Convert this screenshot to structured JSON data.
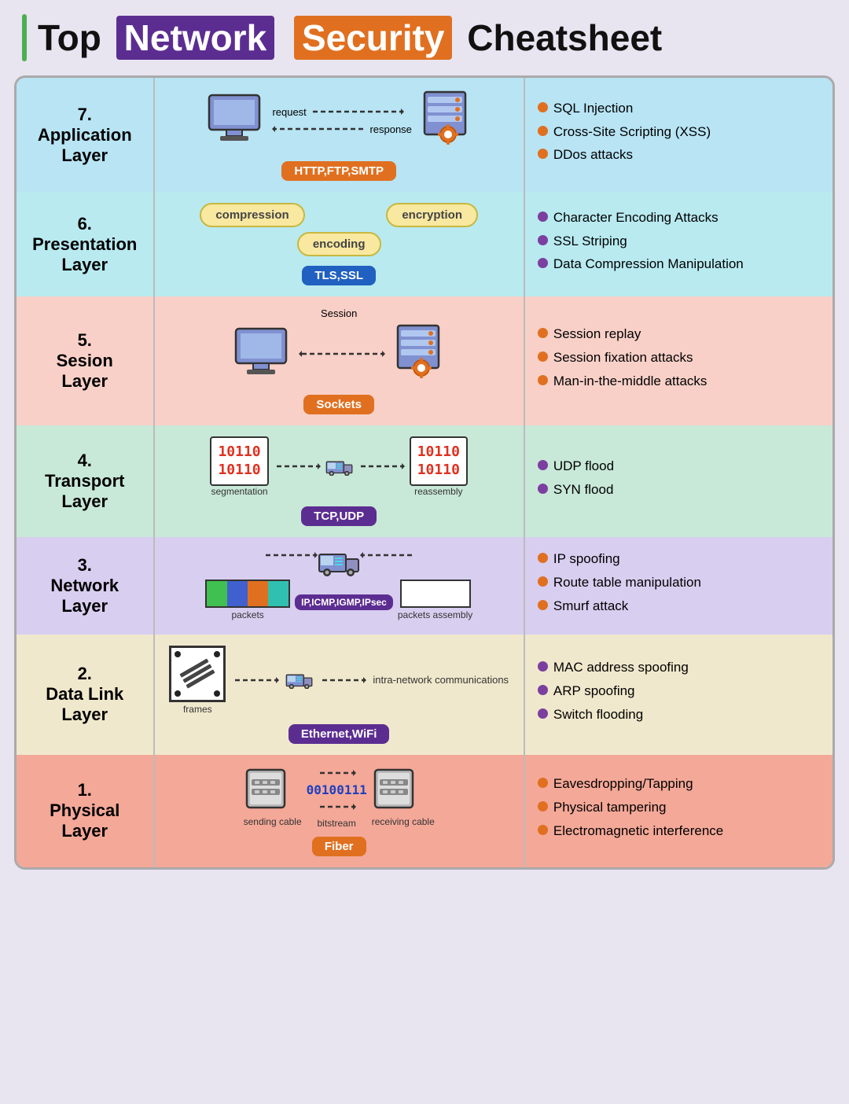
{
  "title": {
    "prefix": "Top",
    "network": "Network",
    "security": "Security",
    "suffix": "Cheatsheet"
  },
  "layers": [
    {
      "id": "application",
      "number": "7.",
      "name": "Application\nLayer",
      "colorClass": "row-application",
      "diagram": {
        "type": "application",
        "request": "request",
        "response": "response",
        "protocol": "HTTP,FTP,SMTP",
        "protocolColor": "orange"
      },
      "attacks": [
        {
          "text": "SQL Injection",
          "dot": "orange"
        },
        {
          "text": "Cross-Site Scripting (XSS)",
          "dot": "orange"
        },
        {
          "text": "DDos attacks",
          "dot": "orange"
        }
      ]
    },
    {
      "id": "presentation",
      "number": "6.",
      "name": "Presentation\nLayer",
      "colorClass": "row-presentation",
      "diagram": {
        "type": "presentation",
        "bubble1": "compression",
        "bubble2": "encryption",
        "bubble3": "encoding",
        "protocol": "TLS,SSL",
        "protocolColor": "blue"
      },
      "attacks": [
        {
          "text": "Character Encoding Attacks",
          "dot": "purple"
        },
        {
          "text": "SSL Striping",
          "dot": "purple"
        },
        {
          "text": "Data Compression Manipulation",
          "dot": "purple"
        }
      ]
    },
    {
      "id": "session",
      "number": "5.",
      "name": "Sesion\nLayer",
      "colorClass": "row-session",
      "diagram": {
        "type": "session",
        "label": "Session",
        "protocol": "Sockets",
        "protocolColor": "orange"
      },
      "attacks": [
        {
          "text": "Session replay",
          "dot": "orange"
        },
        {
          "text": "Session fixation attacks",
          "dot": "orange"
        },
        {
          "text": "Man-in-the-middle attacks",
          "dot": "orange"
        }
      ]
    },
    {
      "id": "transport",
      "number": "4.",
      "name": "Transport\nLayer",
      "colorClass": "row-transport",
      "diagram": {
        "type": "transport",
        "binary": "10110\n10110",
        "segLabel": "segmentation",
        "reassLabel": "reassembly",
        "protocol": "TCP,UDP",
        "protocolColor": "purple"
      },
      "attacks": [
        {
          "text": "UDP flood",
          "dot": "purple"
        },
        {
          "text": "SYN flood",
          "dot": "purple"
        }
      ]
    },
    {
      "id": "network",
      "number": "3.",
      "name": "Network\nLayer",
      "colorClass": "row-network",
      "diagram": {
        "type": "network",
        "packetsLabel": "packets",
        "assemblyLabel": "packets\nassembly",
        "protocol": "IP,ICMP,IGMP,IPsec",
        "protocolColor": "purple"
      },
      "attacks": [
        {
          "text": "IP spoofing",
          "dot": "orange"
        },
        {
          "text": "Route table manipulation",
          "dot": "orange"
        },
        {
          "text": "Smurf attack",
          "dot": "orange"
        }
      ]
    },
    {
      "id": "datalink",
      "number": "2.",
      "name": "Data Link\nLayer",
      "colorClass": "row-datalink",
      "diagram": {
        "type": "datalink",
        "framesLabel": "frames",
        "intraLabel": "intra-network\ncommunications",
        "protocol": "Ethernet,WiFi",
        "protocolColor": "purple"
      },
      "attacks": [
        {
          "text": "MAC address spoofing",
          "dot": "purple"
        },
        {
          "text": "ARP spoofing",
          "dot": "purple"
        },
        {
          "text": "Switch flooding",
          "dot": "purple"
        }
      ]
    },
    {
      "id": "physical",
      "number": "1.",
      "name": "Physical\nLayer",
      "colorClass": "row-physical",
      "diagram": {
        "type": "physical",
        "sendingLabel": "sending\ncable",
        "bitstreamLabel": "bitstream",
        "bitstreamText": "00100111",
        "receivingLabel": "receiving\ncable",
        "protocol": "Fiber",
        "protocolColor": "orange"
      },
      "attacks": [
        {
          "text": "Eavesdropping/Tapping",
          "dot": "orange"
        },
        {
          "text": "Physical tampering",
          "dot": "orange"
        },
        {
          "text": "Electromagnetic interference",
          "dot": "orange"
        }
      ]
    }
  ]
}
